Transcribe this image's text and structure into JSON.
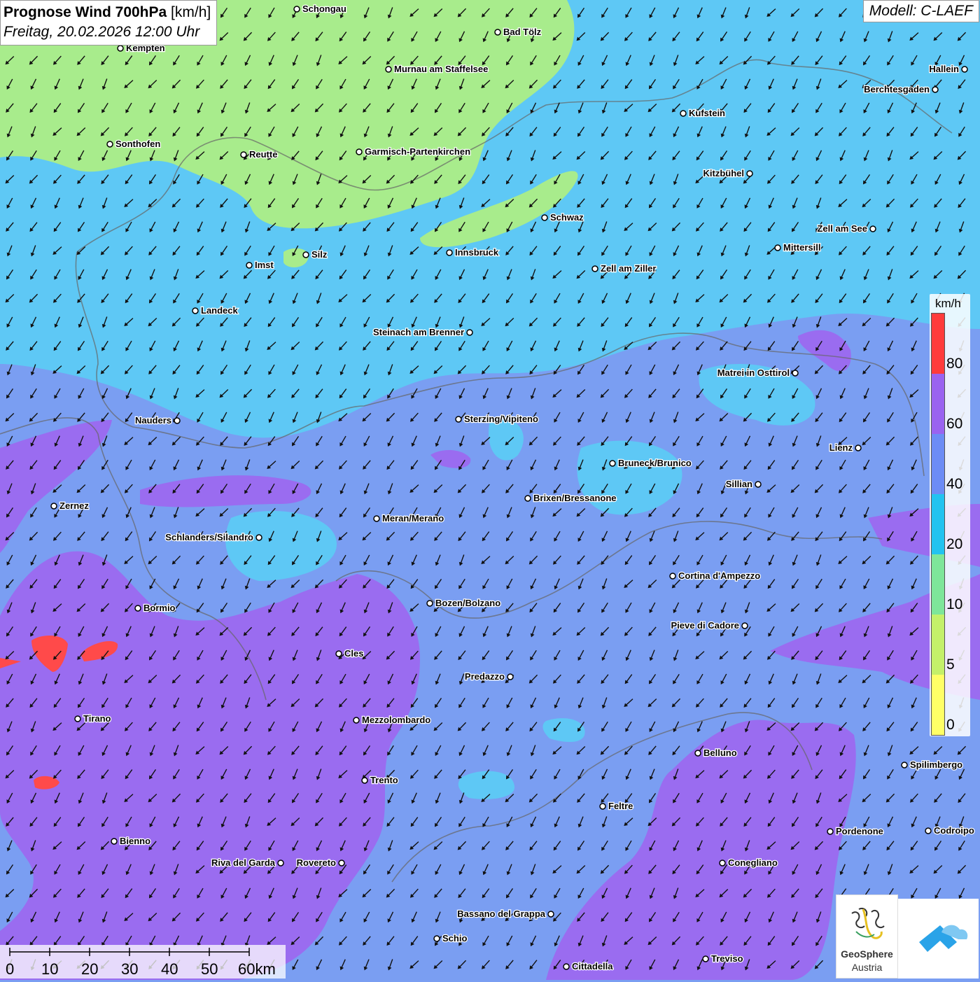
{
  "header": {
    "title_bold": "Prognose Wind 700hPa",
    "title_unit": "[km/h]",
    "subtitle": "Freitag, 20.02.2026 12:00 Uhr",
    "model": "Modell: C-LAEF"
  },
  "legend": {
    "unit": "km/h",
    "labels": [
      "80",
      "60",
      "40",
      "20",
      "10",
      "5",
      "0"
    ],
    "colors": [
      "#ff3b3b",
      "#9a63f0",
      "#6c8cf5",
      "#22c3f0",
      "#7ee69a",
      "#c4f06a",
      "#ffff66"
    ]
  },
  "scalebar": {
    "labels": [
      "0",
      "10",
      "20",
      "30",
      "40",
      "50",
      "60km"
    ]
  },
  "logos": {
    "geosphere_line1": "GeoSphere",
    "geosphere_line2": "Austria"
  },
  "wind_direction": "north-northeast",
  "cities": [
    {
      "name": "Schongau",
      "label_side": "right"
    },
    {
      "name": "Bad Tölz",
      "label_side": "right"
    },
    {
      "name": "Kempten",
      "label_side": "right"
    },
    {
      "name": "Murnau am Staffelsee",
      "label_side": "right"
    },
    {
      "name": "Hallein",
      "label_side": "left"
    },
    {
      "name": "Berchtesgaden",
      "label_side": "left"
    },
    {
      "name": "Kufstein",
      "label_side": "right"
    },
    {
      "name": "Sonthofen",
      "label_side": "right"
    },
    {
      "name": "Reutte",
      "label_side": "right"
    },
    {
      "name": "Garmisch-Partenkirchen",
      "label_side": "right"
    },
    {
      "name": "Kitzbühel",
      "label_side": "left"
    },
    {
      "name": "Schwaz",
      "label_side": "right"
    },
    {
      "name": "Zell am See",
      "label_side": "left"
    },
    {
      "name": "Mittersill",
      "label_side": "right"
    },
    {
      "name": "Innsbruck",
      "label_side": "right"
    },
    {
      "name": "Silz",
      "label_side": "right"
    },
    {
      "name": "Imst",
      "label_side": "right"
    },
    {
      "name": "Zell am Ziller",
      "label_side": "right"
    },
    {
      "name": "Landeck",
      "label_side": "right"
    },
    {
      "name": "Steinach am Brenner",
      "label_side": "left"
    },
    {
      "name": "Matrei in Osttirol",
      "label_side": "left"
    },
    {
      "name": "Nauders",
      "label_side": "left"
    },
    {
      "name": "Sterzing/Vipiteno",
      "label_side": "right"
    },
    {
      "name": "Lienz",
      "label_side": "left"
    },
    {
      "name": "Bruneck/Brunico",
      "label_side": "right"
    },
    {
      "name": "Sillian",
      "label_side": "left"
    },
    {
      "name": "Zernez",
      "label_side": "right"
    },
    {
      "name": "Brixen/Bressanone",
      "label_side": "right"
    },
    {
      "name": "Meran/Merano",
      "label_side": "right"
    },
    {
      "name": "Schlanders/Silandro",
      "label_side": "left"
    },
    {
      "name": "Cortina d'Ampezzo",
      "label_side": "right"
    },
    {
      "name": "Bozen/Bolzano",
      "label_side": "right"
    },
    {
      "name": "Bormio",
      "label_side": "right"
    },
    {
      "name": "Pieve di Cadore",
      "label_side": "left"
    },
    {
      "name": "Cles",
      "label_side": "right"
    },
    {
      "name": "Predazzo",
      "label_side": "left"
    },
    {
      "name": "Tirano",
      "label_side": "right"
    },
    {
      "name": "Mezzolombardo",
      "label_side": "right"
    },
    {
      "name": "Belluno",
      "label_side": "right"
    },
    {
      "name": "Spilimbergo",
      "label_side": "right"
    },
    {
      "name": "Trento",
      "label_side": "right"
    },
    {
      "name": "Feltre",
      "label_side": "right"
    },
    {
      "name": "Pordenone",
      "label_side": "right"
    },
    {
      "name": "Codroipo",
      "label_side": "right"
    },
    {
      "name": "Bienno",
      "label_side": "right"
    },
    {
      "name": "Riva del Garda",
      "label_side": "left"
    },
    {
      "name": "Rovereto",
      "label_side": "left"
    },
    {
      "name": "Conegliano",
      "label_side": "right"
    },
    {
      "name": "Bassano del Grappa",
      "label_side": "left"
    },
    {
      "name": "Schio",
      "label_side": "right"
    },
    {
      "name": "Treviso",
      "label_side": "right"
    },
    {
      "name": "Cittadella",
      "label_side": "right"
    }
  ]
}
